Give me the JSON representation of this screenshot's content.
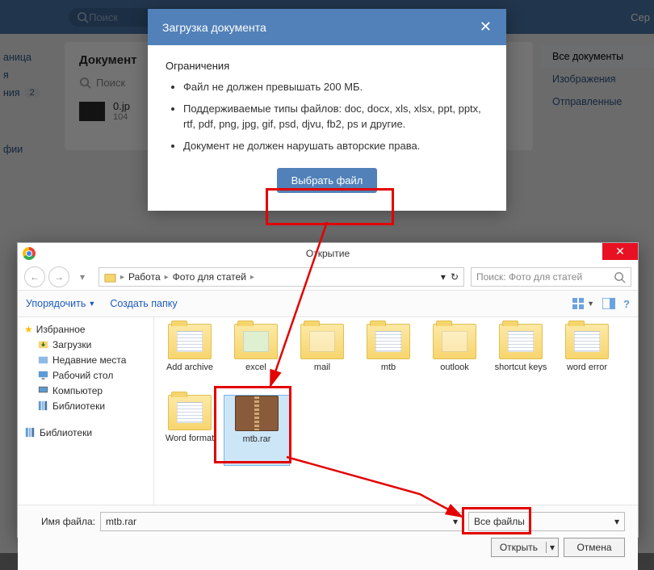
{
  "vk": {
    "search_placeholder": "Поиск",
    "user": "Сер",
    "nav": {
      "page": "аница",
      "docs": "я",
      "msgs": "ния",
      "msg_badge": "2",
      "photos": "фии"
    },
    "content_title": "Документ",
    "doc_search_placeholder": "Поиск",
    "file": {
      "name": "0.jp",
      "size": "104"
    },
    "side": {
      "all": "Все документы",
      "images": "Изображения",
      "sent": "Отправленные"
    }
  },
  "modal": {
    "title": "Загрузка документа",
    "limits_title": "Ограничения",
    "li1": "Файл не должен превышать 200 МБ.",
    "li2": "Поддерживаемые типы файлов: doc, docx, xls, xlsx, ppt, pptx, rtf, pdf, png, jpg, gif, psd, djvu, fb2, ps и другие.",
    "li3": "Документ не должен нарушать авторские права.",
    "button": "Выбрать файл"
  },
  "fdlg": {
    "title": "Открытие",
    "path": {
      "p1": "Работа",
      "p2": "Фото для статей"
    },
    "search_placeholder": "Поиск: Фото для статей",
    "toolbar": {
      "org": "Упорядочить",
      "newf": "Создать папку"
    },
    "tree": {
      "fav": "Избранное",
      "dl": "Загрузки",
      "recent": "Недавние места",
      "desk": "Рабочий стол",
      "comp": "Компьютер",
      "lib": "Библиотеки",
      "lib2": "Библиотеки"
    },
    "files": {
      "f0": "Add archive",
      "f1": "excel",
      "f2": "mail",
      "f3": "mtb",
      "f4": "outlook",
      "f5": "shortcut keys",
      "f6": "word error",
      "f7": "Word format",
      "f8": "mtb.rar"
    },
    "fname_label": "Имя файла:",
    "fname_value": "mtb.rar",
    "filter": "Все файлы",
    "open": "Открыть",
    "cancel": "Отмена"
  }
}
